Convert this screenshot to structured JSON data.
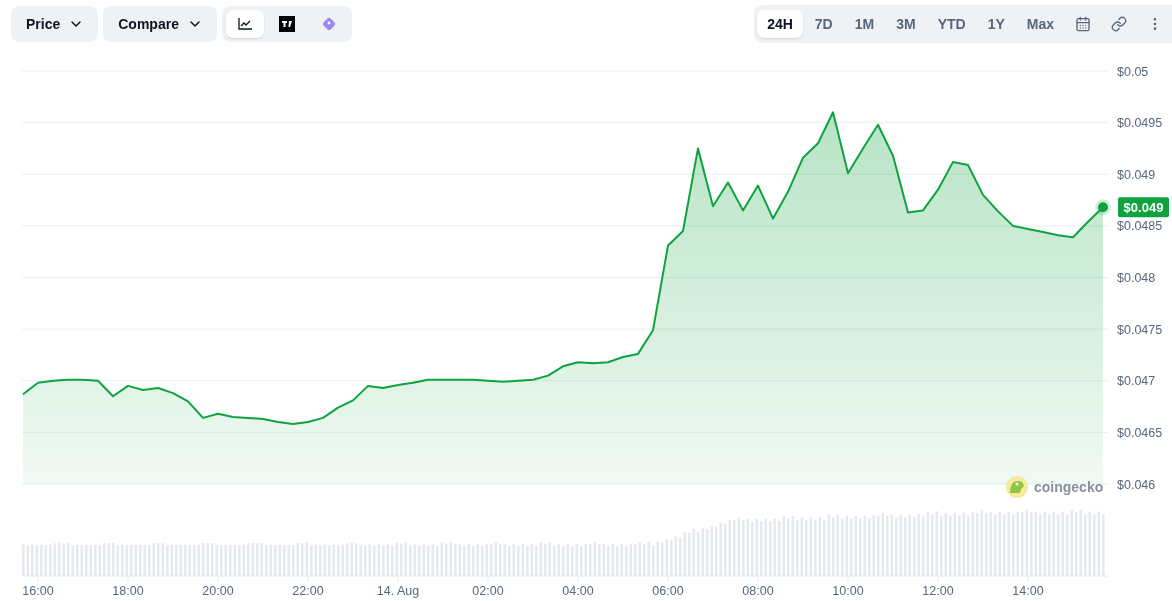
{
  "toolbar": {
    "dropdowns": [
      {
        "label": "Price"
      },
      {
        "label": "Compare"
      }
    ],
    "chart_types": [
      {
        "kind": "line",
        "selected": true
      },
      {
        "kind": "tradingview",
        "selected": false
      },
      {
        "kind": "diamond",
        "selected": false
      }
    ],
    "ranges": [
      {
        "label": "24H",
        "selected": true
      },
      {
        "label": "7D",
        "selected": false
      },
      {
        "label": "1M",
        "selected": false
      },
      {
        "label": "3M",
        "selected": false
      },
      {
        "label": "YTD",
        "selected": false
      },
      {
        "label": "1Y",
        "selected": false
      },
      {
        "label": "Max",
        "selected": false
      }
    ]
  },
  "chart": {
    "price_badge": "$0.049",
    "brand": "coingecko",
    "chart_data": {
      "type": "area",
      "grid": true,
      "ylim": [
        0.046,
        0.05
      ],
      "categories": [
        null,
        "16:00",
        null,
        null,
        null,
        null,
        null,
        "18:00",
        null,
        null,
        null,
        null,
        null,
        "20:00",
        null,
        null,
        null,
        null,
        null,
        "22:00",
        null,
        null,
        null,
        null,
        null,
        "14. Aug",
        null,
        null,
        null,
        null,
        null,
        "02:00",
        null,
        null,
        null,
        null,
        null,
        "04:00",
        null,
        null,
        null,
        null,
        null,
        "06:00",
        null,
        null,
        null,
        null,
        null,
        "08:00",
        null,
        null,
        null,
        null,
        null,
        "10:00",
        null,
        null,
        null,
        null,
        null,
        "12:00",
        null,
        null,
        null,
        null,
        null,
        "14:00",
        null,
        null,
        null,
        null,
        null
      ],
      "series": [
        {
          "color": "#0fa33f",
          "values": [
            0.04687,
            0.04698,
            0.047,
            0.04701,
            0.04701,
            0.047,
            0.04685,
            0.04695,
            0.04691,
            0.04693,
            0.04688,
            0.0468,
            0.04664,
            0.04668,
            0.04665,
            0.04664,
            0.04663,
            0.0466,
            0.04658,
            0.0466,
            0.04664,
            0.04674,
            0.04681,
            0.04695,
            0.04693,
            0.04696,
            0.04698,
            0.04701,
            0.04701,
            0.04701,
            0.04701,
            0.047,
            0.04699,
            0.047,
            0.04701,
            0.04705,
            0.04714,
            0.04718,
            0.04717,
            0.04718,
            0.04723,
            0.04726,
            0.04749,
            0.04831,
            0.04845,
            0.04925,
            0.04869,
            0.04892,
            0.04865,
            0.04889,
            0.04857,
            0.04883,
            0.04916,
            0.0493,
            0.0496,
            0.04901,
            0.04925,
            0.04948,
            0.04918,
            0.04863,
            0.04865,
            0.04885,
            0.04912,
            0.04909,
            0.0488,
            0.04864,
            0.0485,
            0.04847,
            0.04844,
            0.04841,
            0.04839,
            0.04854,
            0.04868
          ]
        }
      ],
      "yticks": [
        {
          "value": 0.05,
          "label": "$0.05"
        },
        {
          "value": 0.0495,
          "label": "$0.0495"
        },
        {
          "value": 0.049,
          "label": "$0.049"
        },
        {
          "value": 0.0485,
          "label": "$0.0485"
        },
        {
          "value": 0.048,
          "label": "$0.048"
        },
        {
          "value": 0.0475,
          "label": "$0.0475"
        },
        {
          "value": 0.047,
          "label": "$0.047"
        },
        {
          "value": 0.0465,
          "label": "$0.0465"
        },
        {
          "value": 0.046,
          "label": "$0.046"
        }
      ]
    }
  }
}
